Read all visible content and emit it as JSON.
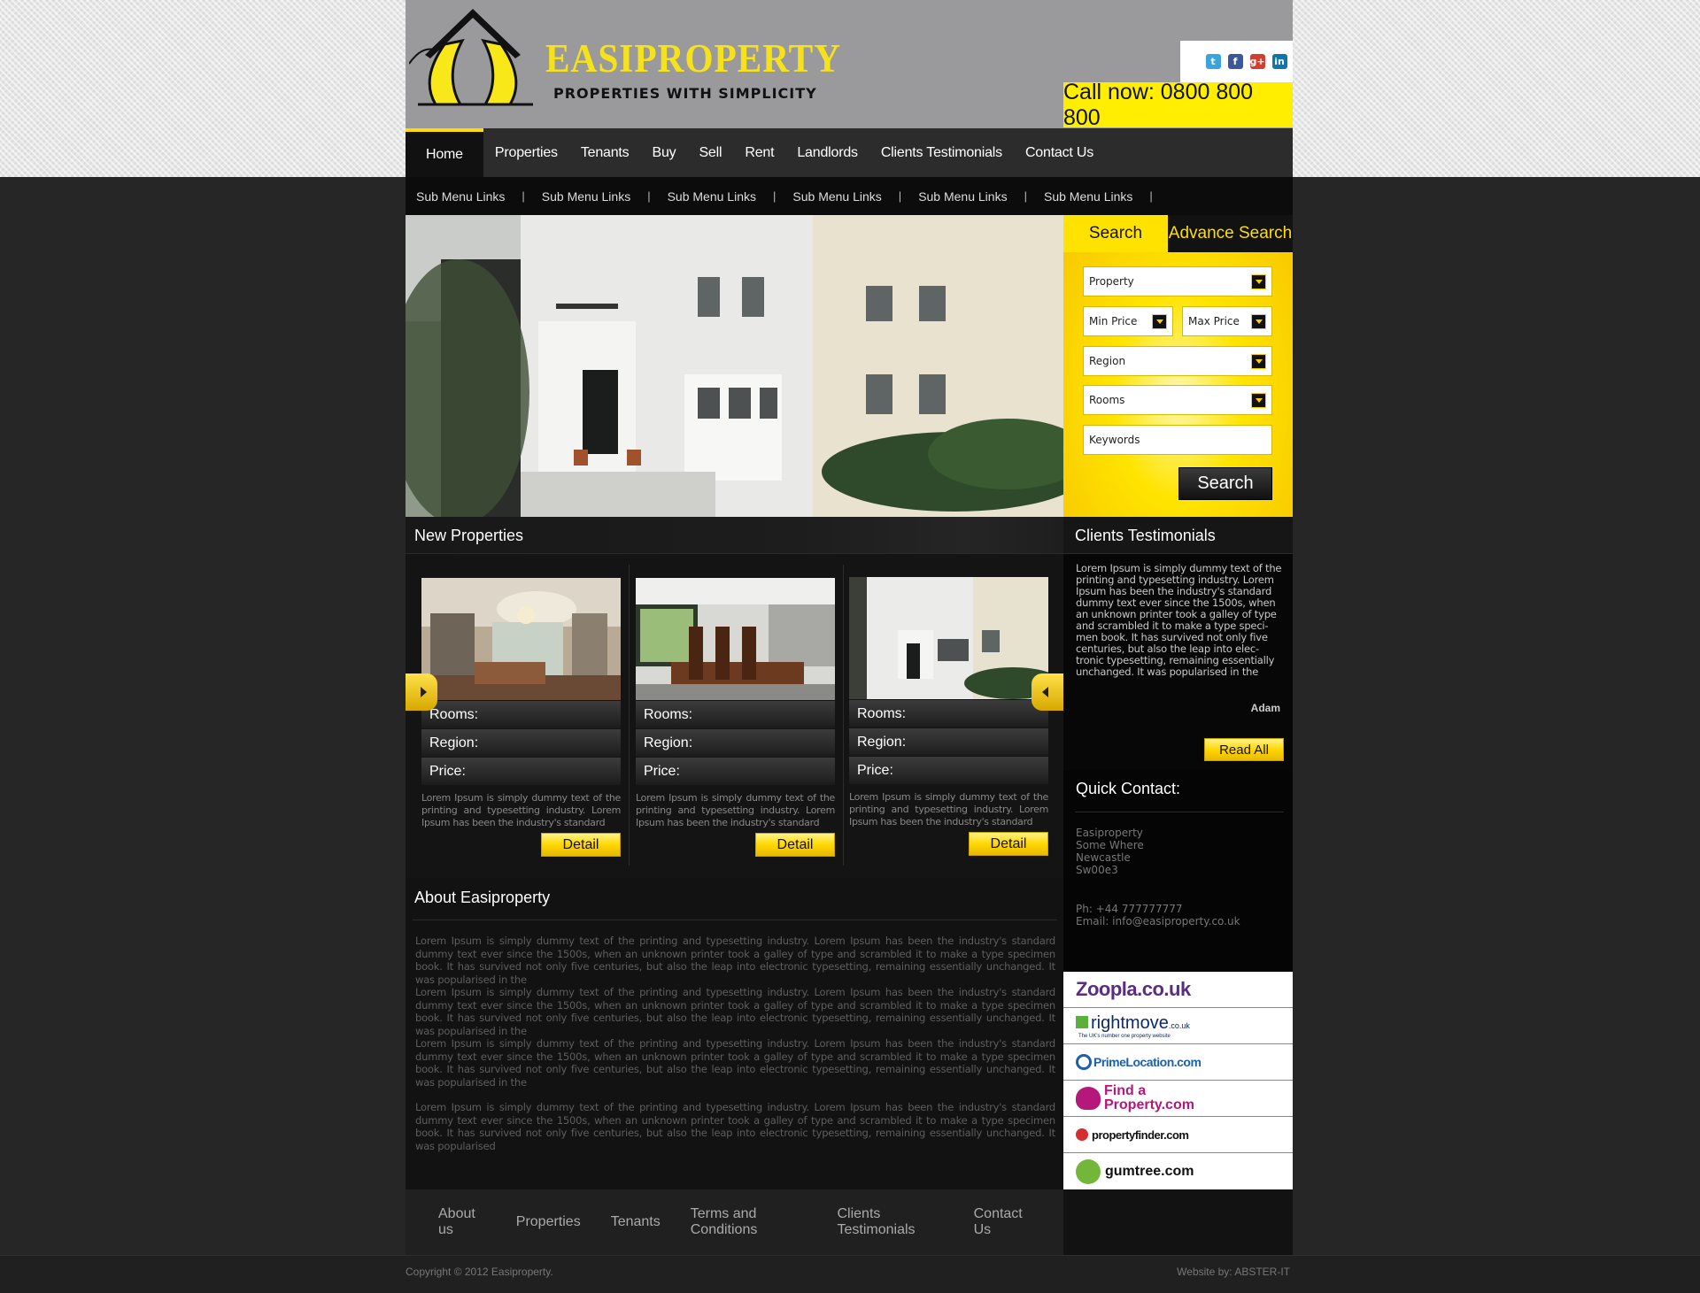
{
  "brand": {
    "name": "EASIPROPERTY",
    "tagline": "PROPERTIES WITH SIMPLICITY",
    "call_now": "Call now: 0800 800 800",
    "colors": {
      "accent": "#ffdd00",
      "dark": "#141414",
      "header_grey": "#9a9a9c"
    }
  },
  "social": [
    {
      "icon": "twitter-icon",
      "glyph": "t",
      "color": "#3aa3d8"
    },
    {
      "icon": "facebook-icon",
      "glyph": "f",
      "color": "#3b5998"
    },
    {
      "icon": "google-plus-icon",
      "glyph": "g+",
      "color": "#d23f31"
    },
    {
      "icon": "linkedin-icon",
      "glyph": "in",
      "color": "#0e76a8"
    }
  ],
  "nav": {
    "items": [
      "Home",
      "Properties",
      "Tenants",
      "Buy",
      "Sell",
      "Rent",
      "Landlords",
      "Clients Testimonials",
      "Contact Us"
    ],
    "active": "Home"
  },
  "subnav": [
    "Sub Menu Links",
    "Sub Menu Links",
    "Sub Menu Links",
    "Sub Menu Links",
    "Sub Menu Links",
    "Sub Menu Links"
  ],
  "search": {
    "tab_search": "Search",
    "tab_advanced": "Advance Search",
    "property": "Property",
    "min_price": "Min Price",
    "max_price": "Max Price",
    "region": "Region",
    "rooms": "Rooms",
    "keywords": "Keywords",
    "button": "Search"
  },
  "new_properties": {
    "title": "New Properties",
    "cards": [
      {
        "rooms": "Rooms:",
        "region": "Region:",
        "price": "Price:",
        "text": "Lorem Ipsum is simply dummy text of the printing and typesetting industry. Lorem Ipsum has been the industry's standard",
        "button": "Detail"
      },
      {
        "rooms": "Rooms:",
        "region": "Region:",
        "price": "Price:",
        "text": "Lorem Ipsum is simply dummy text of the printing and typesetting industry. Lorem Ipsum has been the industry's standard",
        "button": "Detail"
      },
      {
        "rooms": "Rooms:",
        "region": "Region:",
        "price": "Price:",
        "text": "Lorem Ipsum is simply dummy text of the printing and typesetting industry. Lorem Ipsum has been the industry's standard",
        "button": "Detail"
      }
    ]
  },
  "about": {
    "title": "About  Easiproperty",
    "paragraphs": [
      "Lorem Ipsum is simply dummy text of the printing and typesetting industry. Lorem Ipsum has been the industry's standard dummy text ever since the 1500s, when an unknown printer took a galley of type and scrambled it to make a type specimen book. It has survived not only five centuries, but also the leap into electronic typesetting, remaining essentially unchanged. It was popularised in the",
      "Lorem Ipsum is simply dummy text of the printing and typesetting industry. Lorem Ipsum has been the industry's standard dummy text ever since the 1500s, when an unknown printer took a galley of type and scrambled it to make a type specimen book. It has survived not only five centuries, but also the leap into electronic typesetting, remaining essentially unchanged. It was popularised in the",
      "Lorem Ipsum is simply dummy text of the printing and typesetting industry. Lorem Ipsum has been the industry's standard dummy text ever since the 1500s, when an unknown printer took a galley of type and scrambled it to make a type specimen book. It has survived not only five centuries, but also the leap into electronic typesetting, remaining essentially unchanged. It was popularised in the",
      "Lorem Ipsum is simply dummy text of the printing and typesetting industry. Lorem Ipsum has been the industry's standard dummy text ever since the 1500s, when an unknown printer took a galley of type and scrambled it to make a type specimen book. It has survived not only five centuries, but also the leap into electronic typesetting, remaining essentially unchanged. It was popularised"
    ]
  },
  "testimonials": {
    "title": "Clients Testimonials",
    "text": "Lorem Ipsum is simply dummy text of the printing and typesetting industry. Lorem Ipsum has been the industry's standard dummy text ever since the 1500s, when an unknown printer took a galley of type and scrambled it to make a type speci- men book. It has survived not only five centuries, but also the leap into elec- tronic typesetting, remaining essentially unchanged. It was popularised in the",
    "author": "Adam",
    "button": "Read All"
  },
  "quick_contact": {
    "title": "Quick Contact:",
    "address": [
      "Easiproperty",
      "Some Where",
      "Newcastle",
      "Sw00e3"
    ],
    "phone": "Ph: +44 777777777",
    "email": "Email: info@easiproperty.co.uk"
  },
  "partners": [
    {
      "name": "Zoopla.co.uk",
      "icon": "zoopla-logo",
      "color": "#5a2d82"
    },
    {
      "name": "rightmove",
      "suffix": ".co.uk",
      "sub": "The UK's number one property website",
      "icon": "rightmove-logo",
      "color": "#0c2a6a"
    },
    {
      "name": "PrimeLocation.com",
      "icon": "primelocation-logo",
      "color": "#1d5fa8"
    },
    {
      "name": "Find a Property.com",
      "icon": "findaproperty-logo",
      "color": "#b5177a"
    },
    {
      "name": "propertyfinder.com",
      "icon": "propertyfinder-logo",
      "color": "#111111"
    },
    {
      "name": "gumtree.com",
      "icon": "gumtree-logo",
      "color": "#111111"
    }
  ],
  "footer": {
    "links": [
      "About us",
      "Properties",
      "Tenants",
      "Terms and Conditions",
      "Clients Testimonials",
      "Contact Us"
    ],
    "copyright": "Copyright © 2012 Easiproperty.",
    "website_by": "Website by: ABSTER-IT"
  }
}
